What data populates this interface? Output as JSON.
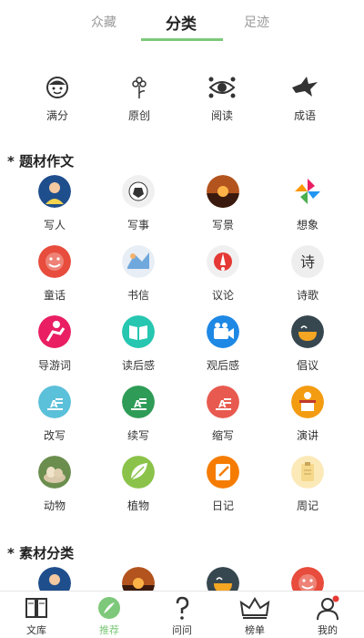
{
  "tabs": {
    "items": [
      {
        "label": "众藏"
      },
      {
        "label": "分类"
      },
      {
        "label": "足迹"
      }
    ],
    "active_index": 1,
    "accent_color": "#7dc87a"
  },
  "quick_links": [
    {
      "label": "满分",
      "icon": "smiley-face-icon"
    },
    {
      "label": "原创",
      "icon": "flower-icon"
    },
    {
      "label": "阅读",
      "icon": "eye-icon"
    },
    {
      "label": "成语",
      "icon": "bird-icon"
    }
  ],
  "section1": {
    "title": "* 题材作文",
    "items": [
      {
        "label": "写人",
        "icon": "person-icon",
        "color": "#1f4e8c"
      },
      {
        "label": "写事",
        "icon": "soccer-icon",
        "color": "#f0f0f0"
      },
      {
        "label": "写景",
        "icon": "sunset-icon",
        "color": "#b3541e"
      },
      {
        "label": "想象",
        "icon": "pinwheel-icon",
        "color": "#ffffff"
      },
      {
        "label": "童话",
        "icon": "smile-face-icon",
        "color": "#e74c3c"
      },
      {
        "label": "书信",
        "icon": "letter-icon",
        "color": "#e8eef5"
      },
      {
        "label": "议论",
        "icon": "speech-icon",
        "color": "#f0f0f0"
      },
      {
        "label": "诗歌",
        "icon": "poem-icon",
        "color": "#eeeeee"
      },
      {
        "label": "导游词",
        "icon": "runner-icon",
        "color": "#e91e63"
      },
      {
        "label": "读后感",
        "icon": "book-icon",
        "color": "#26c6b0"
      },
      {
        "label": "观后感",
        "icon": "camera-icon",
        "color": "#1e88e5"
      },
      {
        "label": "倡议",
        "icon": "bowl-icon",
        "color": "#37474f"
      },
      {
        "label": "改写",
        "icon": "doc-icon",
        "color": "#5bc0d9"
      },
      {
        "label": "续写",
        "icon": "doc-icon",
        "color": "#2e9c56"
      },
      {
        "label": "缩写",
        "icon": "doc-icon",
        "color": "#e85a4f"
      },
      {
        "label": "演讲",
        "icon": "podium-icon",
        "color": "#f39c12"
      },
      {
        "label": "动物",
        "icon": "animal-icon",
        "color": "#6b8e4e"
      },
      {
        "label": "植物",
        "icon": "leaf-icon",
        "color": "#8bc34a"
      },
      {
        "label": "日记",
        "icon": "notebook-icon",
        "color": "#f57c00"
      },
      {
        "label": "周记",
        "icon": "clipboard-icon",
        "color": "#fbe9b8"
      }
    ]
  },
  "section2": {
    "title": "* 素材分类",
    "items": [
      {
        "icon": "person-icon",
        "color": "#1f4e8c"
      },
      {
        "icon": "sunset-icon",
        "color": "#b3541e"
      },
      {
        "icon": "bowl-icon",
        "color": "#37474f"
      },
      {
        "icon": "smile-face-icon",
        "color": "#e74c3c"
      }
    ]
  },
  "bottom_nav": {
    "items": [
      {
        "label": "文库",
        "icon": "book-open-icon"
      },
      {
        "label": "推荐",
        "icon": "feather-icon"
      },
      {
        "label": "问问",
        "icon": "question-icon"
      },
      {
        "label": "榜单",
        "icon": "crown-icon"
      },
      {
        "label": "我的",
        "icon": "user-icon"
      }
    ],
    "active_index": 1
  }
}
